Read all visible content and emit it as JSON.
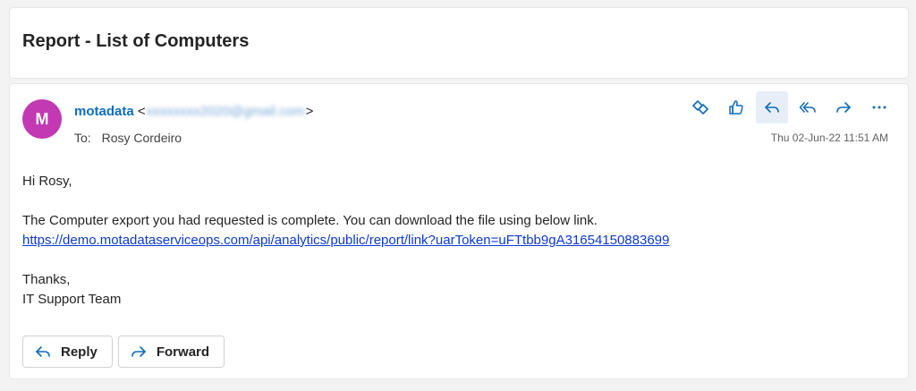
{
  "subject": "Report - List of Computers",
  "sender": {
    "avatar_letter": "M",
    "name": "motadata",
    "email": "xxxxxxxx2020@gmail.com",
    "open_bracket": "<",
    "close_bracket": ">",
    "avatar_color": "#c239b3"
  },
  "recipient": {
    "label": "To:",
    "name": "Rosy Cordeiro"
  },
  "timestamp": "Thu 02-Jun-22 11:51 AM",
  "toolbar_icons": [
    "copilot-icon",
    "like-icon",
    "reply-icon",
    "reply-all-icon",
    "forward-icon",
    "more-icon"
  ],
  "body": {
    "greeting": "Hi Rosy,",
    "line1": "The Computer export you had requested is complete. You can download the file using below link.",
    "link": "https://demo.motadataserviceops.com/api/analytics/public/report/link?uarToken=uFTtbb9gA31654150883699",
    "signoff1": "Thanks,",
    "signoff2": "IT Support Team"
  },
  "actions": {
    "reply_label": "Reply",
    "forward_label": "Forward"
  },
  "colors": {
    "accent": "#0f6cbd",
    "link": "#0b3ad3"
  }
}
